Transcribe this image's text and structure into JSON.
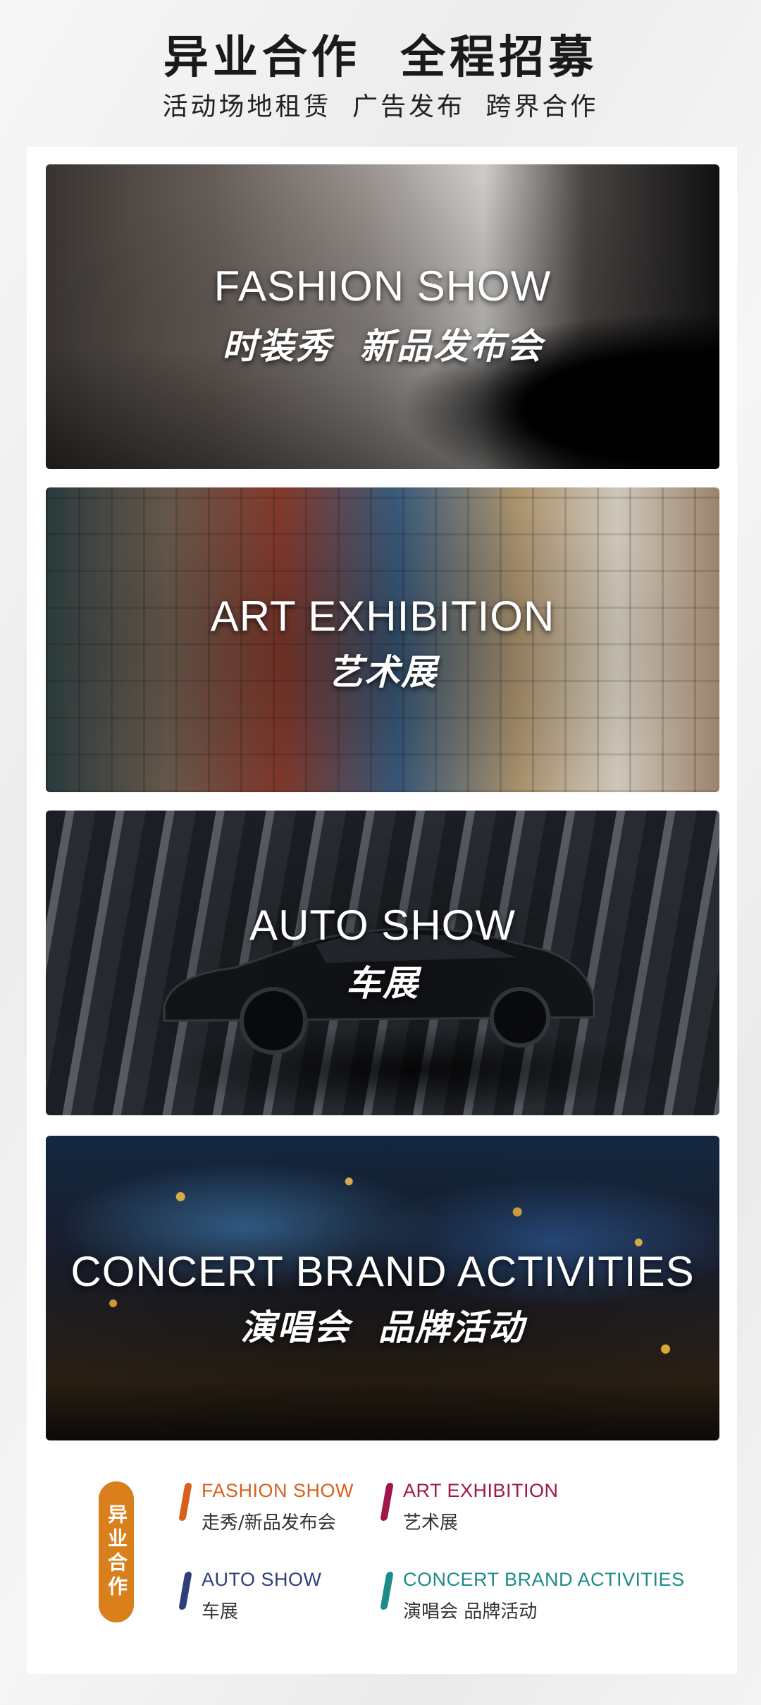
{
  "header": {
    "title": "异业合作  全程招募",
    "subtitle": "活动场地租赁 广告发布 跨界合作"
  },
  "cards": [
    {
      "en": "FASHION SHOW",
      "cn": "时装秀  新品发布会"
    },
    {
      "en": "ART EXHIBITION",
      "cn": "艺术展"
    },
    {
      "en": "AUTO SHOW",
      "cn": "车展"
    },
    {
      "en": "CONCERT BRAND ACTIVITIES",
      "cn": "演唱会  品牌活动"
    }
  ],
  "legend": {
    "badge": "异业合作",
    "items": [
      {
        "en": "FASHION SHOW",
        "cn": "走秀/新品发布会",
        "color": "#d9601c"
      },
      {
        "en": "ART  EXHIBITION",
        "cn": "艺术展",
        "color": "#a0164a"
      },
      {
        "en": "AUTO SHOW",
        "cn": "车展",
        "color": "#2f3f78"
      },
      {
        "en": "CONCERT  BRAND ACTIVITIES",
        "cn": "演唱会 品牌活动",
        "color": "#1d8c88"
      }
    ]
  }
}
